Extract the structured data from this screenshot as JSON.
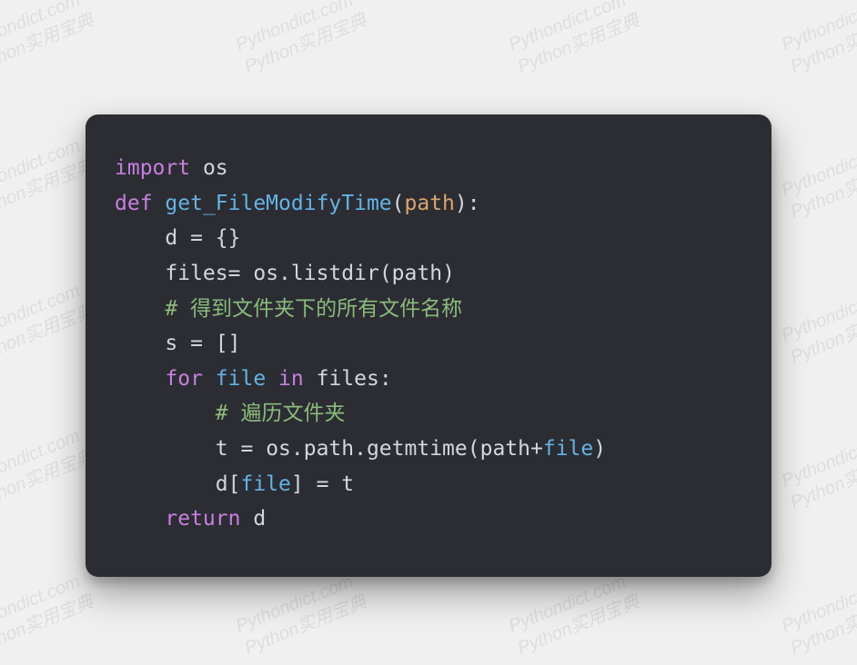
{
  "watermark": {
    "line1": "Pythondict.com",
    "line2": "Python实用宝典"
  },
  "code": {
    "kw_import": "import",
    "mod_os": "os",
    "kw_def": "def",
    "fn_name": "get_FileModifyTime",
    "param_path": "path",
    "var_d": "d",
    "dict_lit": "{}",
    "var_files": "files",
    "call_listdir_prefix": "os.listdir(",
    "call_listdir_arg": "path",
    "call_close": ")",
    "comment1": "# 得到文件夹下的所有文件名称",
    "var_s": "s",
    "list_lit": "[]",
    "kw_for": "for",
    "var_file": "file",
    "kw_in": "in",
    "loop_iter": "files",
    "colon": ":",
    "comment2": "# 遍历文件夹",
    "var_t": "t",
    "call_getmtime_prefix": "os.path.getmtime(",
    "arg_path": "path",
    "op_plus": "+",
    "arg_file": "file",
    "d_open": "d[",
    "d_key": "file",
    "d_close": "]",
    "eq": " = ",
    "eq2": "= ",
    "kw_return": "return",
    "ret_val": "d"
  }
}
